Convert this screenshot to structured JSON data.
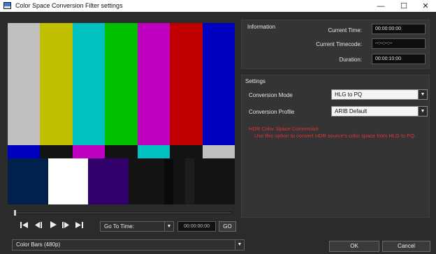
{
  "window": {
    "title": "Color Space Conversion Filter settings",
    "minimize_glyph": "—",
    "maximize_glyph": "☐",
    "close_glyph": "✕"
  },
  "preview": {
    "top_bars": [
      "#c0c0c0",
      "#c0c000",
      "#00c0c0",
      "#00c000",
      "#c000c0",
      "#c00000",
      "#0000c0"
    ],
    "mid_bars": [
      "#0000c0",
      "#131313",
      "#c000c0",
      "#131313",
      "#00c0c0",
      "#131313",
      "#c0c0c0"
    ],
    "bottom_bars": [
      "#00214c",
      "#ffffff",
      "#32006a",
      "#131313",
      "#090909",
      "#131313",
      "#1d1d1d",
      "#131313"
    ]
  },
  "transport": {
    "first_icon": "skip-to-start-icon",
    "prev_icon": "previous-frame-icon",
    "play_icon": "play-icon",
    "next_icon": "next-frame-icon",
    "last_icon": "skip-to-end-icon",
    "goto_label": "Go To Time:",
    "time_value": "00:00:00:00",
    "go_label": "GO"
  },
  "source": {
    "selected": "Color Bars (480p)"
  },
  "information": {
    "title": "Information",
    "current_time_label": "Current Time:",
    "current_time_value": "00:00:00:00",
    "current_timecode_label": "Current Timecode:",
    "current_timecode_value": "--:--:--:--",
    "duration_label": "Duration:",
    "duration_value": "00:00:10:00"
  },
  "settings": {
    "title": "Settings",
    "mode_label": "Conversion Mode",
    "mode_value": "HLG to PQ",
    "profile_label": "Conversion Profile",
    "profile_value": "ARIB Default",
    "note_title": "HDR Color Space Conversion",
    "note_body": "Use this option to convert HDR source's color space from HLG to PQ."
  },
  "buttons": {
    "ok": "OK",
    "cancel": "Cancel"
  },
  "colors": {
    "background": "#2b2b2b",
    "panel": "#343434",
    "note_red": "#e53333"
  }
}
